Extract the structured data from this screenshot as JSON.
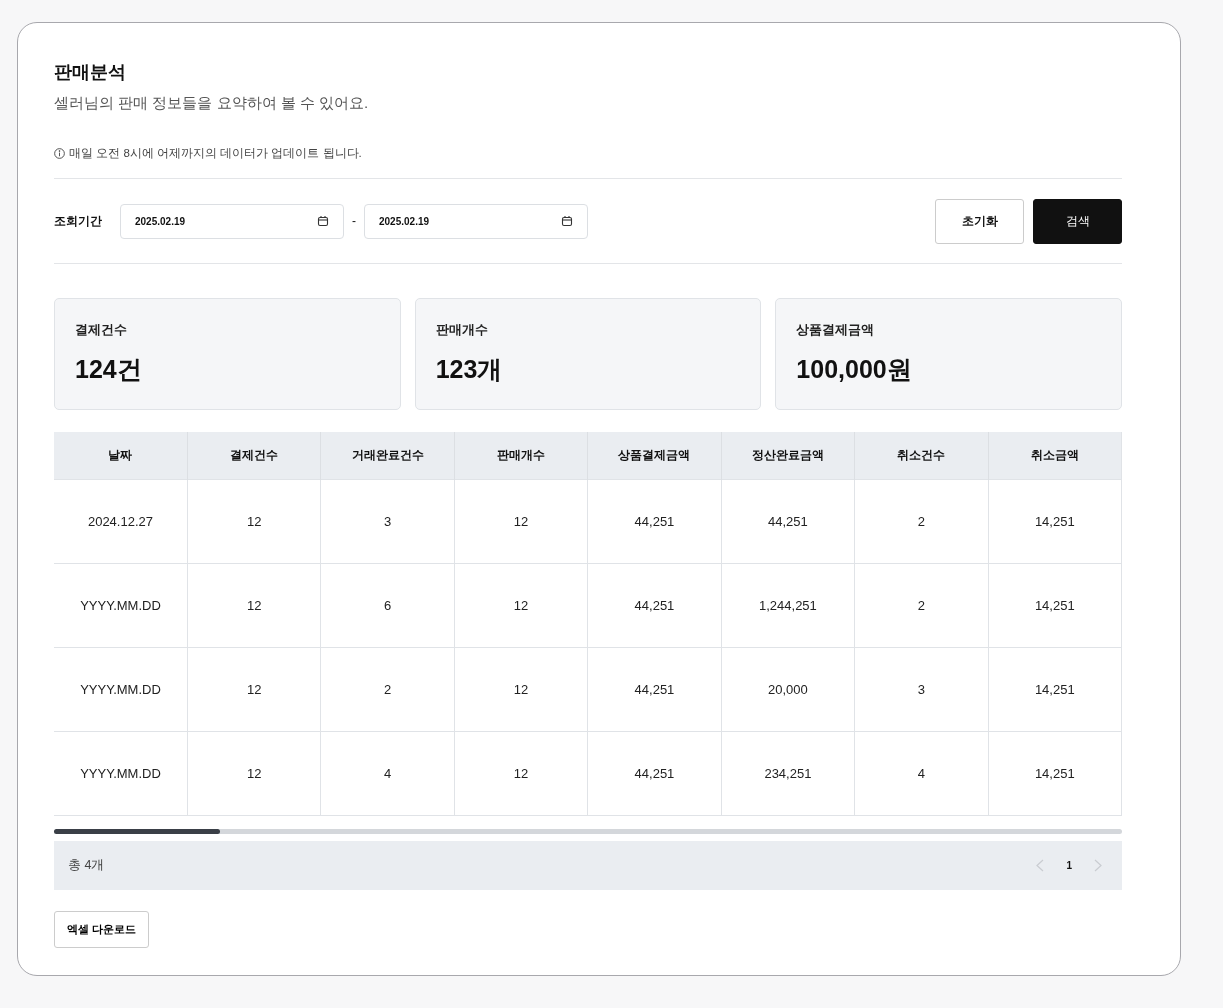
{
  "header": {
    "title": "판매분석",
    "subtitle": "셀러님의 판매 정보들을 요약하여 볼 수 있어요.",
    "notice": "매일 오전 8시에 어제까지의 데이터가 업데이트 됩니다."
  },
  "filter": {
    "label": "조회기간",
    "start_date": "2025.02.19",
    "separator": "-",
    "end_date": "2025.02.19",
    "buttons": [
      {
        "label": "초기화",
        "kind": "secondary"
      },
      {
        "label": "검색",
        "kind": "primary"
      }
    ]
  },
  "summary_cards": [
    {
      "label": "결제건수",
      "value": "124건"
    },
    {
      "label": "판매개수",
      "value": "123개"
    },
    {
      "label": "상품결제금액",
      "value": "100,000원"
    }
  ],
  "table": {
    "columns": [
      "날짜",
      "결제건수",
      "거래완료건수",
      "판매개수",
      "상품결제금액",
      "정산완료금액",
      "취소건수",
      "취소금액"
    ],
    "rows": [
      [
        "2024.12.27",
        "12",
        "3",
        "12",
        "44,251",
        "44,251",
        "2",
        "14,251"
      ],
      [
        "YYYY.MM.DD",
        "12",
        "6",
        "12",
        "44,251",
        "1,244,251",
        "2",
        "14,251"
      ],
      [
        "YYYY.MM.DD",
        "12",
        "2",
        "12",
        "44,251",
        "20,000",
        "3",
        "14,251"
      ],
      [
        "YYYY.MM.DD",
        "12",
        "4",
        "12",
        "44,251",
        "234,251",
        "4",
        "14,251"
      ]
    ]
  },
  "footer": {
    "total": "총 4개",
    "prev_disabled": true,
    "next_disabled": true,
    "pages": [
      {
        "label": "1",
        "selected": true
      }
    ]
  },
  "download_button": "엑셀 다운로드"
}
